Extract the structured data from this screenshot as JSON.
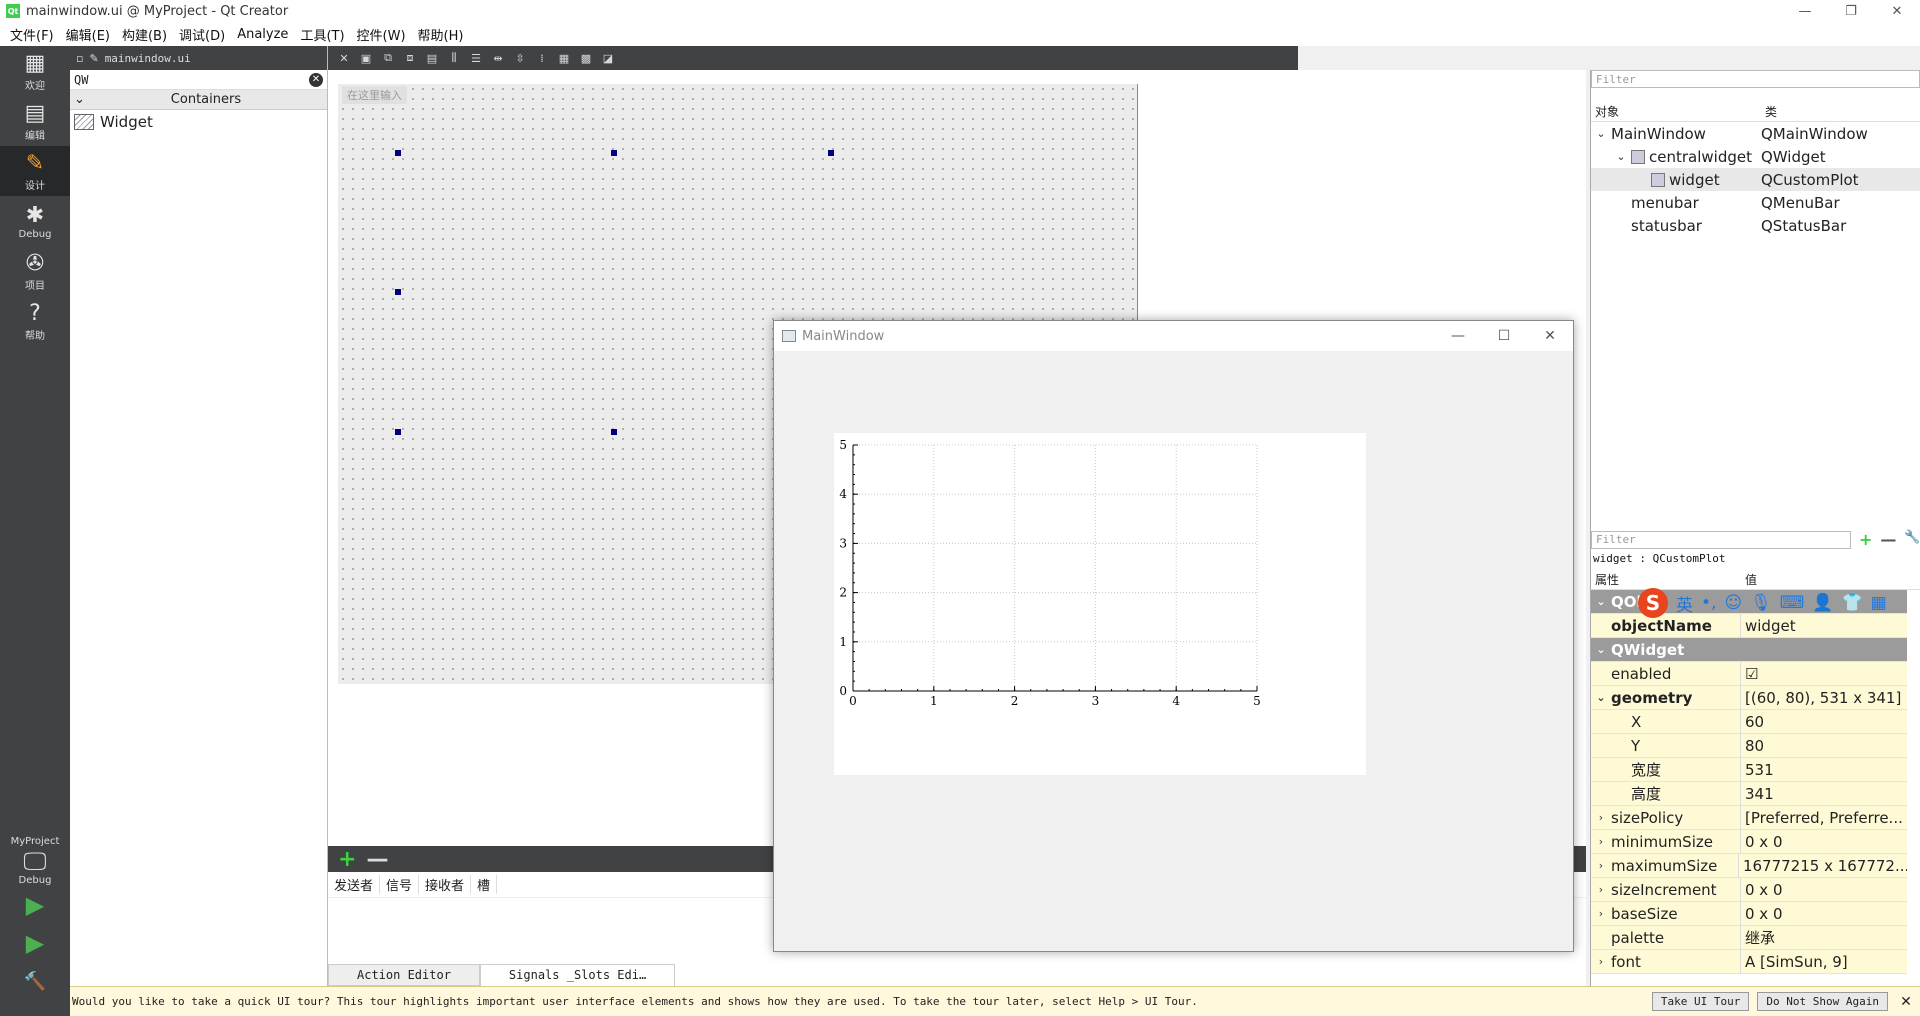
{
  "window": {
    "title": "mainwindow.ui @ MyProject - Qt Creator",
    "app_icon": "qt-logo-icon",
    "minimize": "—",
    "restore": "❐",
    "close": "✕"
  },
  "menu": [
    "文件(F)",
    "编辑(E)",
    "构建(B)",
    "调试(D)",
    "Analyze",
    "工具(T)",
    "控件(W)",
    "帮助(H)"
  ],
  "modes": [
    {
      "label": "欢迎",
      "icon": "grid-icon",
      "glyph": "▦"
    },
    {
      "label": "编辑",
      "icon": "edit-doc-icon",
      "glyph": "▤"
    },
    {
      "label": "设计",
      "icon": "pencil-icon",
      "glyph": "✎"
    },
    {
      "label": "Debug",
      "icon": "bug-icon",
      "glyph": "✱"
    },
    {
      "label": "项目",
      "icon": "wrench-icon",
      "glyph": "✇"
    },
    {
      "label": "帮助",
      "icon": "help-icon",
      "glyph": "?"
    }
  ],
  "target": {
    "project": "MyProject",
    "config": "Debug",
    "monitor_glyph": "🖵",
    "run_glyph": "▶",
    "debug_run_glyph": "▶",
    "build_glyph": "🔨"
  },
  "widget_box": {
    "doc_tab": "mainwindow.ui",
    "search": "QW",
    "clear_glyph": "✕",
    "category": "Containers",
    "category_arrow": "⌄",
    "item": "Widget"
  },
  "form": {
    "menu_placeholder": "在这里输入"
  },
  "signals": {
    "add": "+",
    "remove": "—",
    "columns": [
      "发送者",
      "信号",
      "接收者",
      "槽"
    ]
  },
  "bottom_tabs": [
    "Action Editor",
    "Signals _Slots Edi…"
  ],
  "object_inspector": {
    "filter_placeholder": "Filter",
    "headers": [
      "对象",
      "类"
    ],
    "rows": [
      {
        "name": "MainWindow",
        "cls": "QMainWindow",
        "level": 0,
        "arrow": "⌄"
      },
      {
        "name": "centralwidget",
        "cls": "QWidget",
        "level": 1,
        "arrow": "⌄"
      },
      {
        "name": "widget",
        "cls": "QCustomPlot",
        "level": 2,
        "arrow": ""
      },
      {
        "name": "menubar",
        "cls": "QMenuBar",
        "level": 1,
        "arrow": ""
      },
      {
        "name": "statusbar",
        "cls": "QStatusBar",
        "level": 1,
        "arrow": ""
      }
    ]
  },
  "property_editor": {
    "filter_placeholder": "Filter",
    "add": "+",
    "remove": "—",
    "config": "🔧",
    "object_label": "widget : QCustomPlot",
    "headers": [
      "属性",
      "值"
    ],
    "rows": [
      {
        "name": "QOb",
        "value": "",
        "kind": "group",
        "arrow": "⌄"
      },
      {
        "name": "objectName",
        "value": "widget",
        "kind": "bold-yellow",
        "arrow": ""
      },
      {
        "name": "QWidget",
        "value": "",
        "kind": "group",
        "arrow": "⌄"
      },
      {
        "name": "enabled",
        "value": "☑",
        "kind": "yellow",
        "arrow": ""
      },
      {
        "name": "geometry",
        "value": "[(60, 80), 531 x 341]",
        "kind": "bold-yellow",
        "arrow": "⌄"
      },
      {
        "name": "X",
        "value": "60",
        "kind": "sub",
        "arrow": ""
      },
      {
        "name": "Y",
        "value": "80",
        "kind": "sub",
        "arrow": ""
      },
      {
        "name": "宽度",
        "value": "531",
        "kind": "sub",
        "arrow": ""
      },
      {
        "name": "高度",
        "value": "341",
        "kind": "sub",
        "arrow": ""
      },
      {
        "name": "sizePolicy",
        "value": "[Preferred, Preferre...",
        "kind": "yellow",
        "arrow": "›"
      },
      {
        "name": "minimumSize",
        "value": "0 x 0",
        "kind": "yellow",
        "arrow": "›"
      },
      {
        "name": "maximumSize",
        "value": "16777215 x 167772...",
        "kind": "yellow",
        "arrow": "›"
      },
      {
        "name": "sizeIncrement",
        "value": "0 x 0",
        "kind": "yellow",
        "arrow": "›"
      },
      {
        "name": "baseSize",
        "value": "0 x 0",
        "kind": "yellow",
        "arrow": "›"
      },
      {
        "name": "palette",
        "value": "继承",
        "kind": "yellow",
        "arrow": ""
      },
      {
        "name": "font",
        "value": "A  [SimSun, 9]",
        "kind": "yellow",
        "arrow": "›"
      }
    ]
  },
  "ime": {
    "logo": "S",
    "mode": "英",
    "punct": "•,",
    "icons": [
      "smiley-icon",
      "microphone-icon",
      "keyboard-icon",
      "user-icon",
      "shirt-icon",
      "apps-icon"
    ],
    "glyphs": [
      "☺",
      "🎙",
      "⌨",
      "👤",
      "👕",
      "▦"
    ]
  },
  "preview": {
    "title": "MainWindow",
    "minimize": "—",
    "maximize": "☐",
    "close": "✕"
  },
  "chart_data": {
    "type": "line",
    "title": "",
    "xlabel": "",
    "ylabel": "",
    "xlim": [
      0,
      5
    ],
    "ylim": [
      0,
      5
    ],
    "x_ticks": [
      "0",
      "1",
      "2",
      "3",
      "4",
      "5"
    ],
    "y_ticks": [
      "0",
      "1",
      "2",
      "3",
      "4",
      "5"
    ],
    "grid": true,
    "series": []
  },
  "tour": {
    "message": "Would you like to take a quick UI tour? This tour highlights important user interface elements and shows how they are used. To take the tour later, select Help > UI Tour.",
    "take": "Take UI Tour",
    "dont": "Do Not Show Again",
    "close": "✕"
  }
}
